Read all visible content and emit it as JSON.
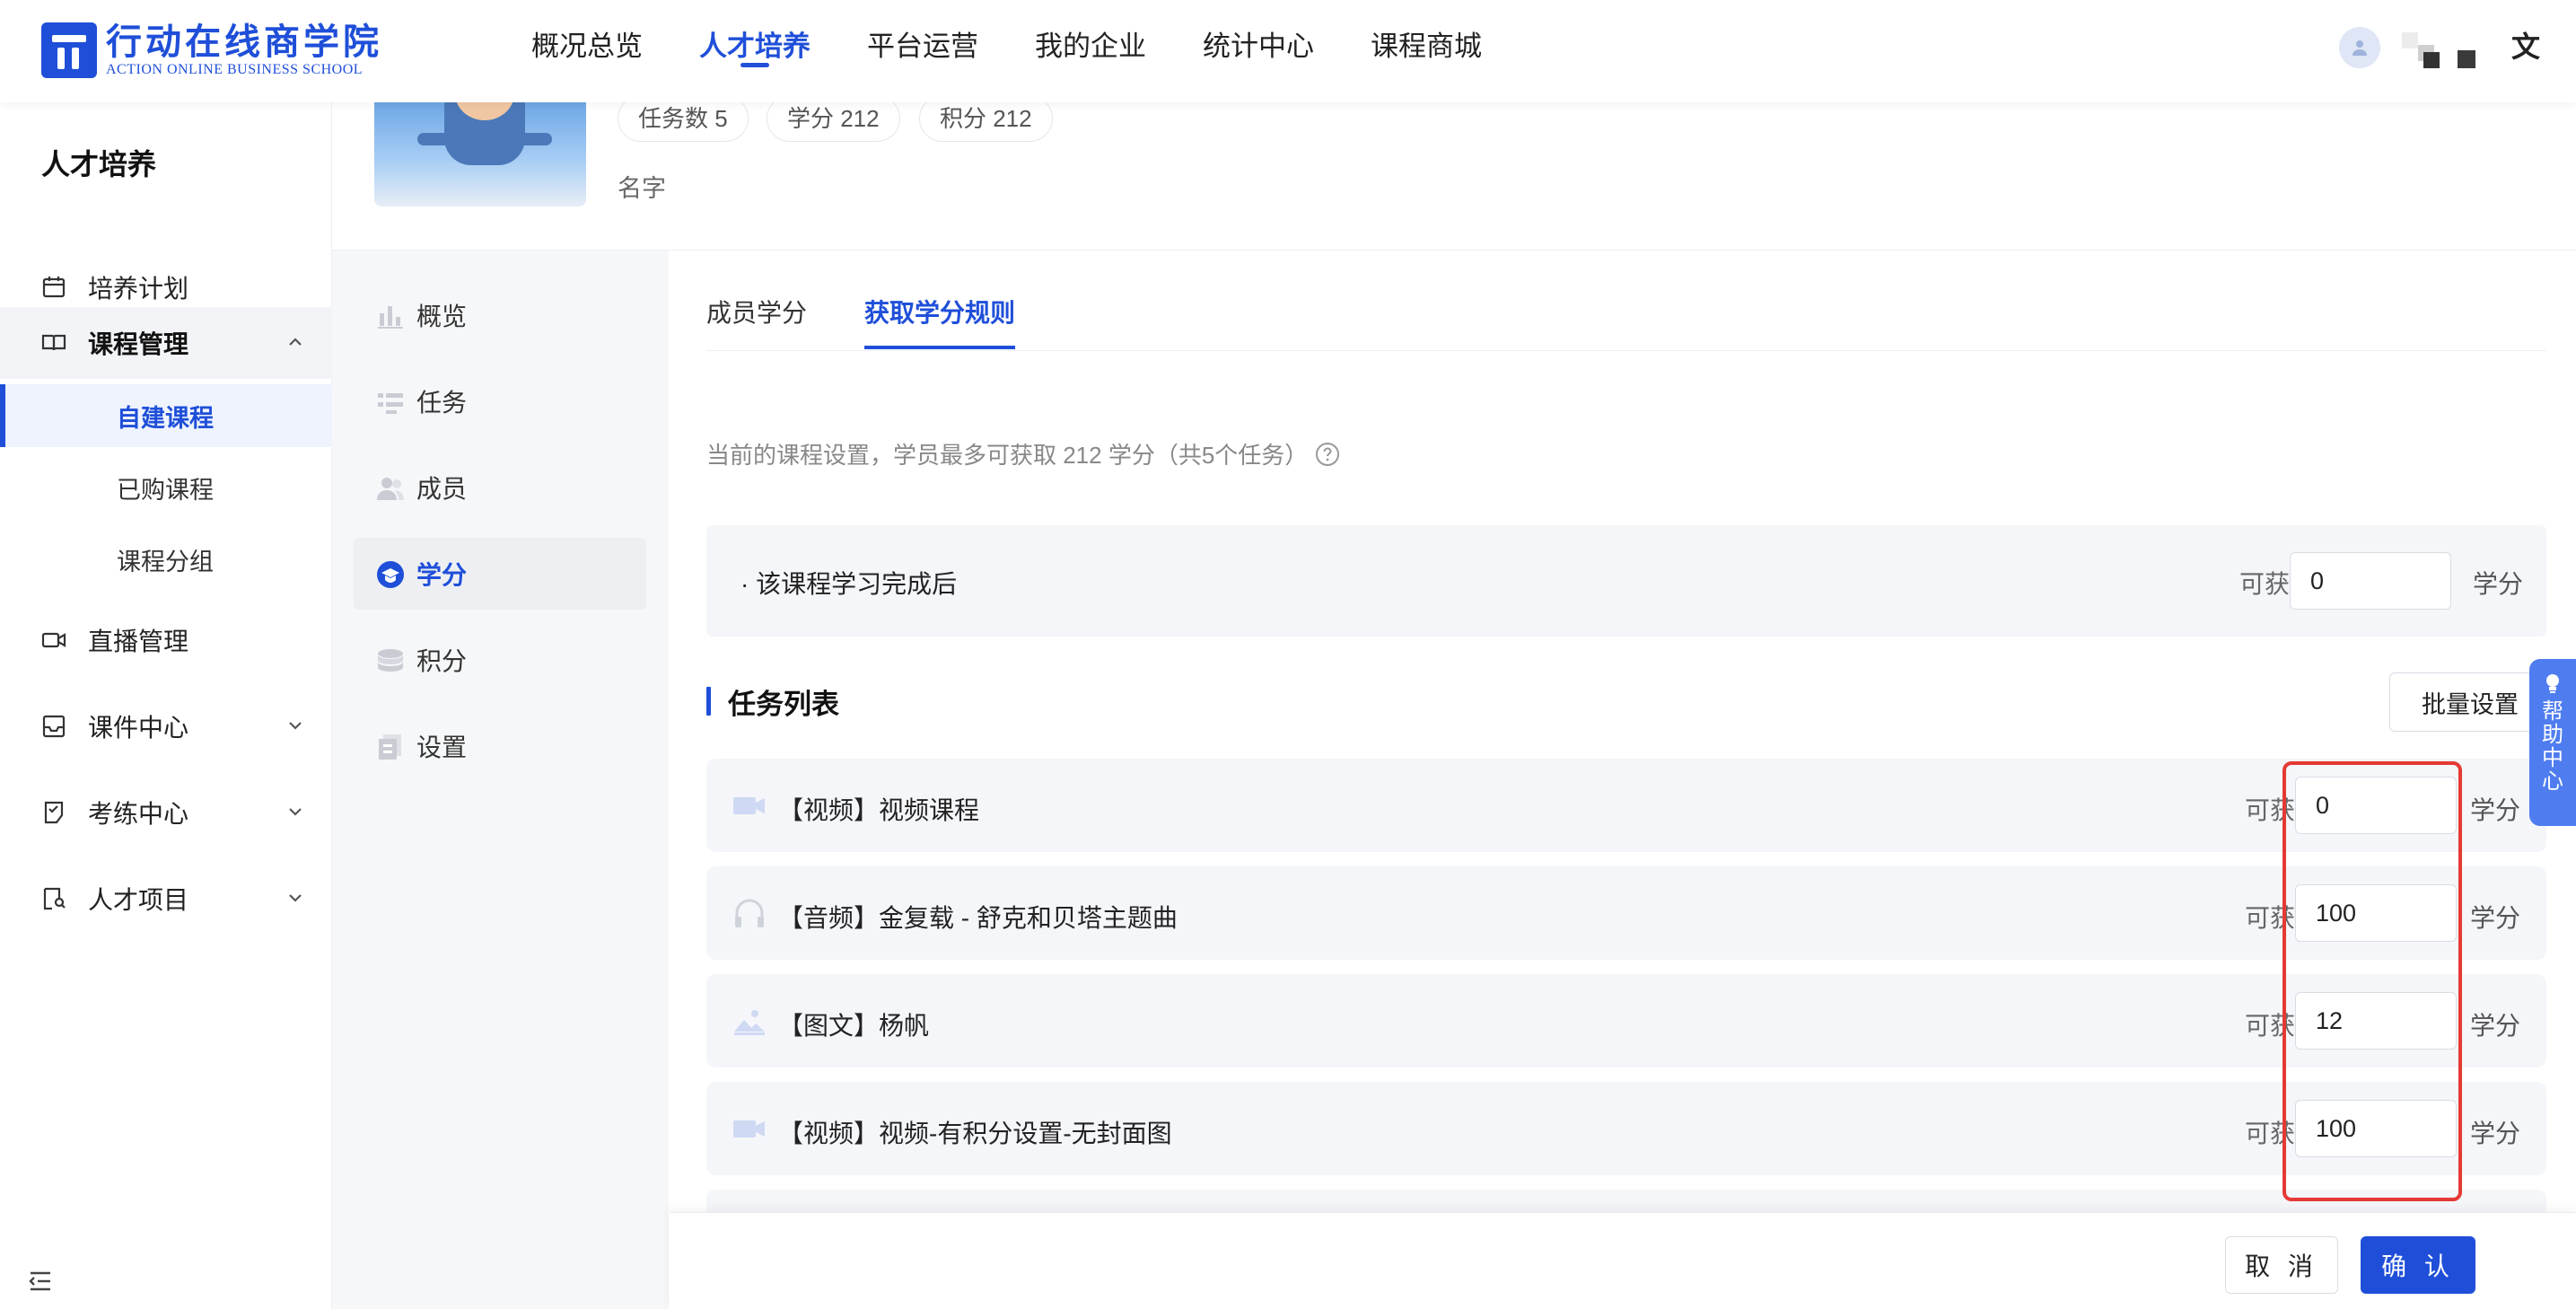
{
  "brand": {
    "name_cn": "行动在线商学院",
    "name_en": "ACTION ONLINE BUSINESS SCHOOL",
    "color": "#1f4fd9"
  },
  "topnav": {
    "items": [
      {
        "label": "概况总览"
      },
      {
        "label": "人才培养",
        "active": true
      },
      {
        "label": "平台运营"
      },
      {
        "label": "我的企业"
      },
      {
        "label": "统计中心"
      },
      {
        "label": "课程商城"
      }
    ],
    "lang_icon": "translate-icon"
  },
  "sidebar": {
    "title": "人才培养",
    "items": [
      {
        "label": "培养计划",
        "icon": "calendar-icon"
      },
      {
        "label": "课程管理",
        "icon": "book-icon",
        "expanded": true,
        "children": [
          {
            "label": "自建课程",
            "active": true
          },
          {
            "label": "已购课程"
          },
          {
            "label": "课程分组"
          }
        ]
      },
      {
        "label": "直播管理",
        "icon": "video-camera-icon"
      },
      {
        "label": "课件中心",
        "icon": "inbox-icon"
      },
      {
        "label": "考练中心",
        "icon": "exam-icon"
      },
      {
        "label": "人才项目",
        "icon": "person-doc-icon"
      }
    ]
  },
  "course": {
    "name": "名字",
    "stats": [
      {
        "label": "任务数 5"
      },
      {
        "label": "学分 212"
      },
      {
        "label": "积分 212"
      }
    ]
  },
  "course_menu": {
    "items": [
      {
        "label": "概览",
        "icon": "bar-chart-icon"
      },
      {
        "label": "任务",
        "icon": "task-list-icon"
      },
      {
        "label": "成员",
        "icon": "members-icon"
      },
      {
        "label": "学分",
        "icon": "credit-icon",
        "active": true
      },
      {
        "label": "积分",
        "icon": "coins-icon"
      },
      {
        "label": "设置",
        "icon": "settings-doc-icon"
      }
    ]
  },
  "tabs": [
    {
      "label": "成员学分"
    },
    {
      "label": "获取学分规则",
      "active": true
    }
  ],
  "hint": "当前的课程设置，学员最多可获取 212 学分（共5个任务）",
  "completion": {
    "label": "· 该课程学习完成后",
    "gain_label": "可获得",
    "value": "0",
    "unit": "学分"
  },
  "task_section": {
    "title": "任务列表",
    "batch_label": "批量设置",
    "gain_label": "可获得",
    "unit": "学分",
    "tasks": [
      {
        "name": "【视频】视频课程",
        "icon": "video-icon",
        "value": "0"
      },
      {
        "name": "【音频】金复载 - 舒克和贝塔主题曲",
        "icon": "headphones-icon",
        "value": "100"
      },
      {
        "name": "【图文】杨帆",
        "icon": "image-icon",
        "value": "12"
      },
      {
        "name": "【视频】视频-有积分设置-无封面图",
        "icon": "video-icon",
        "value": "100"
      }
    ]
  },
  "help": {
    "label": "帮助中心"
  },
  "footer": {
    "cancel": "取 消",
    "confirm": "确 认"
  },
  "colors": {
    "accent": "#1f4fd9",
    "highlight": "#e53935",
    "row_bg": "#f4f6f9"
  }
}
